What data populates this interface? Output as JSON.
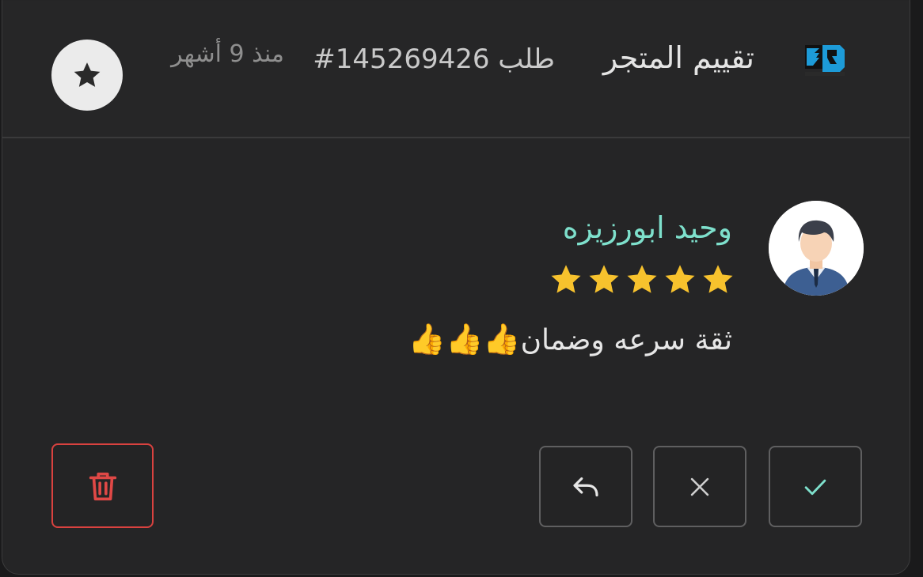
{
  "header": {
    "title": "تقييم المتجر",
    "order_number": "طلب 145269426#",
    "time_ago": "منذ 9 أشهر",
    "logo_icon": "store-logo-icon",
    "rating_badge_icon": "star-icon"
  },
  "review": {
    "reviewer_name": "وحيد ابورزيزه",
    "rating": 5,
    "rating_max": 5,
    "comment": "ثقة سرعه وضمان",
    "comment_emoji": "👍👍👍",
    "avatar_icon": "user-avatar-icon"
  },
  "actions": {
    "approve_icon": "check-icon",
    "reject_icon": "close-icon",
    "reply_icon": "reply-icon",
    "delete_icon": "trash-icon"
  },
  "colors": {
    "accent": "#7ee0cc",
    "star": "#f7c22d",
    "delete": "#d9423f",
    "background": "#252526"
  }
}
